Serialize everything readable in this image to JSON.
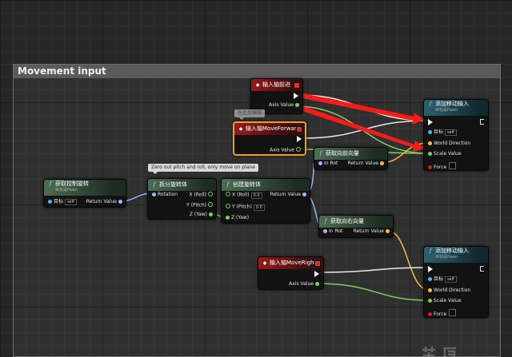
{
  "comment": {
    "title": "Movement input"
  },
  "colors": {
    "exec": "#f0f0f0",
    "float": "#7bd05e",
    "vector": "#f2c22e",
    "rotator": "#9db6ff",
    "object": "#4fb1ff",
    "arrow": "#ff1a1a"
  },
  "nodes": {
    "input_axis_forward": {
      "title": "输入轴前进",
      "out_axis_value": "Axis Value"
    },
    "input_axis_moveforward": {
      "title": "输入轴MoveForward",
      "out_axis_value": "Axis Value",
      "bubble": "在此处编辑"
    },
    "get_control_rotation": {
      "title": "获取控制旋转",
      "subtitle": "目标是Pawn",
      "in_target": "目标",
      "target_value": "self",
      "out_return": "Return Value"
    },
    "break_rotator": {
      "title": "拆分旋转体",
      "in_rotation": "Rotation",
      "out_x": "X (Roll)",
      "out_y": "Y (Pitch)",
      "out_z": "Z (Yaw)",
      "bubble": "Zero out pitch and roll, only move on plane"
    },
    "make_rotator": {
      "title": "创建旋转体",
      "in_x": "X (Roll)",
      "x_value": "0.0",
      "in_y": "Y (Pitch)",
      "y_value": "0.0",
      "in_z": "Z (Yaw)",
      "out_return": "Return Value"
    },
    "get_forward_vector": {
      "title": "获取向前向量",
      "in_rot": "In Rot",
      "out_return": "Return Value"
    },
    "get_right_vector": {
      "title": "获取向右向量",
      "in_rot": "In Rot",
      "out_return": "Return Value"
    },
    "add_movement_input_1": {
      "title": "添加移动输入",
      "subtitle": "目标是Pawn",
      "in_target": "目标",
      "target_value": "self",
      "in_world_direction": "World Direction",
      "in_scale_value": "Scale Value",
      "in_force": "Force"
    },
    "input_axis_moveright": {
      "title": "输入轴MoveRight",
      "out_axis_value": "Axis Value"
    },
    "add_movement_input_2": {
      "title": "添加移动输入",
      "subtitle": "目标是Pawn",
      "in_target": "目标",
      "target_value": "self",
      "in_world_direction": "World Direction",
      "in_scale_value": "Scale Value",
      "in_force": "Force"
    }
  }
}
